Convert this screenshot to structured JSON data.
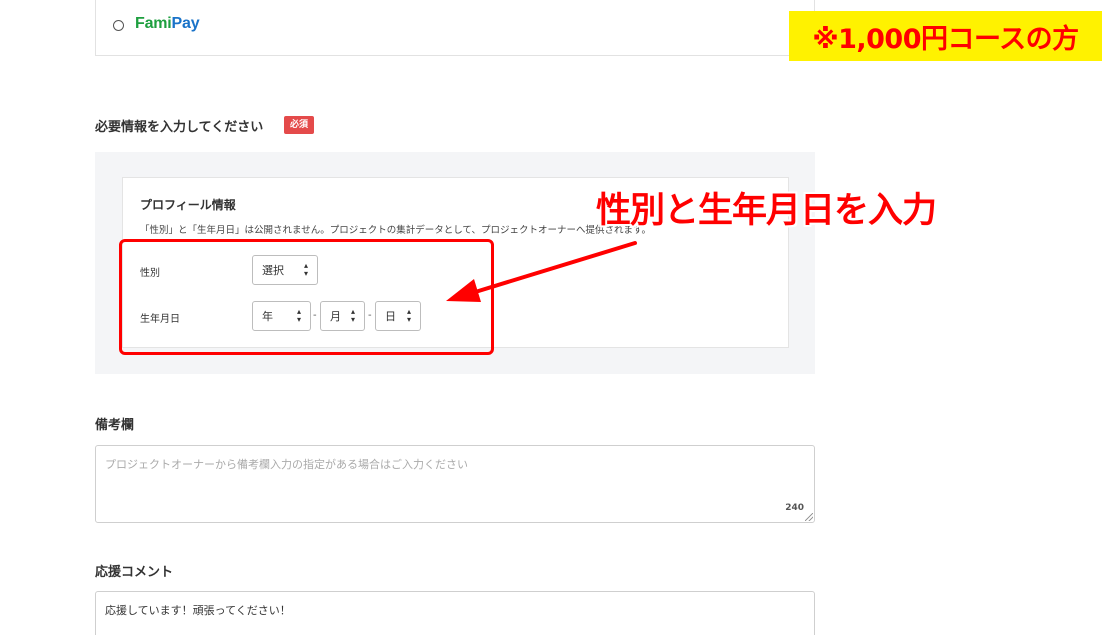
{
  "payment": {
    "logo_fami": "Fami",
    "logo_pay": "Pay"
  },
  "course_banner": "※1,000円コースの方",
  "required_section": {
    "title": "必要情報を入力してください",
    "badge": "必須"
  },
  "profile": {
    "title": "プロフィール情報",
    "note": "「性別」と「生年月日」は公開されません。プロジェクトの集計データとして、プロジェクトオーナーへ提供されます。",
    "gender_label": "性別",
    "gender_value": "選択",
    "birthday_label": "生年月日",
    "year_value": "年",
    "month_value": "月",
    "day_value": "日",
    "separator": "-"
  },
  "annotation": {
    "text": "性別と生年月日を入力",
    "color": "#ff0000"
  },
  "remarks": {
    "title": "備考欄",
    "placeholder": "プロジェクトオーナーから備考欄入力の指定がある場合はご入力ください",
    "char_count": "240"
  },
  "comment": {
    "title": "応援コメント",
    "value": "応援しています！頑張ってください！"
  },
  "icons": {
    "radio": "radio-icon",
    "select_arrow": "up-down-caret-icon",
    "resize": "resize-grip-icon",
    "arrow": "annotation-arrow-icon"
  }
}
